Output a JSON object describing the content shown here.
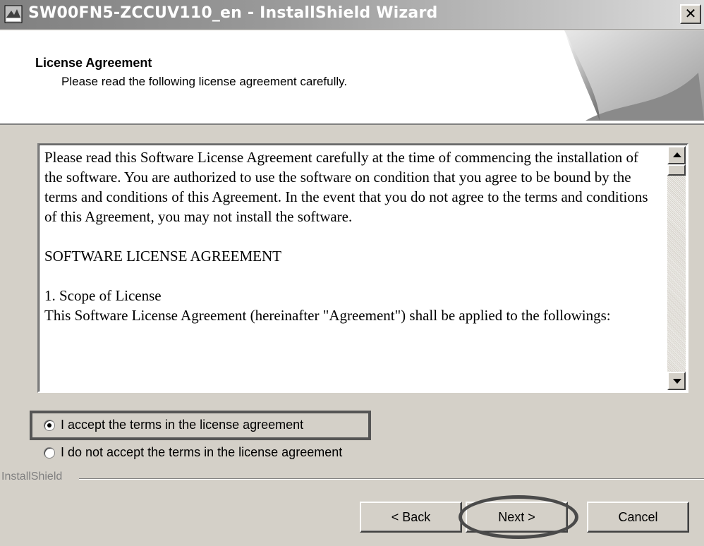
{
  "window": {
    "title": "SW00FN5-ZCCUV110_en - InstallShield Wizard",
    "close_glyph": "✕",
    "icon": "installer-icon"
  },
  "header": {
    "title": "License Agreement",
    "subtitle": "Please read the following license agreement carefully."
  },
  "license": {
    "paragraph1": "Please read this Software License Agreement carefully at the time of commencing the installation of the software. You are authorized to use the software on condition that you agree to be bound by the terms and conditions of this Agreement. In the event that you do not agree to the terms and conditions of this Agreement, you may not install the software.",
    "heading": "SOFTWARE LICENSE AGREEMENT",
    "section_title": "1. Scope of License",
    "section_text": "This Software License Agreement (hereinafter \"Agreement\") shall be applied to the followings:"
  },
  "options": {
    "accept_label": "I accept the terms in the license agreement",
    "decline_label": "I do not accept the terms in the license agreement",
    "selected": "accept"
  },
  "footer": {
    "group_label": "InstallShield"
  },
  "buttons": {
    "back": "< Back",
    "next": "Next >",
    "cancel": "Cancel"
  }
}
